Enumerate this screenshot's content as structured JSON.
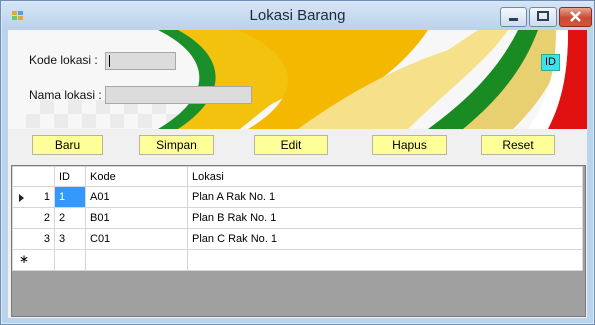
{
  "window": {
    "title": "Lokasi Barang",
    "accent": "#bcd3ec",
    "close_color": "#c84b2f"
  },
  "form": {
    "kode_label": "Kode lokasi :",
    "kode_value": "",
    "nama_label": "Nama lokasi :",
    "nama_value": "",
    "id_tag": "ID"
  },
  "buttons": {
    "baru": "Baru",
    "simpan": "Simpan",
    "edit": "Edit",
    "hapus": "Hapus",
    "reset": "Reset",
    "color": "#ffff9a"
  },
  "grid": {
    "columns": [
      "ID",
      "Kode",
      "Lokasi"
    ],
    "rows": [
      {
        "num": "1",
        "id": "1",
        "kode": "A01",
        "lokasi": "Plan A Rak No. 1"
      },
      {
        "num": "2",
        "id": "2",
        "kode": "B01",
        "lokasi": "Plan B Rak No. 1"
      },
      {
        "num": "3",
        "id": "3",
        "kode": "C01",
        "lokasi": "Plan C Rak No. 1"
      }
    ],
    "selection_color": "#3399ff"
  }
}
